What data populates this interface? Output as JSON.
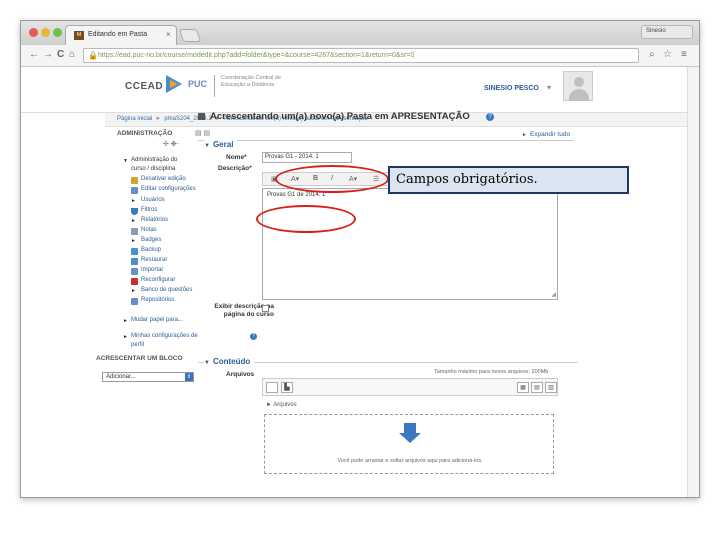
{
  "browser": {
    "tab_title": "Editando em Pasta",
    "tab_favicon": "M",
    "tab_close": "×",
    "user_chip": "Sinesio",
    "url": "https://ead.puc-rio.br/course/modedit.php?add=folder&type=&course=4267&section=1&return=0&sr=0",
    "nav": {
      "back": "←",
      "forward": "→",
      "reload": "C",
      "home": "⌂"
    },
    "toolbar_icons": {
      "bookmark": "☆",
      "zoom": "⌕",
      "menu": "≡"
    }
  },
  "header": {
    "logo_text": "CCEAD",
    "logo_puc": "PUC",
    "subtitle": "Coordenação Central de Educação a Distância",
    "username": "SINESIO PESCO",
    "user_caret": "▾"
  },
  "breadcrumb": [
    "Página inicial",
    "pmaS204_2014.2",
    "Acrescentando um(a) novo(a) pasta em Apresentação"
  ],
  "breadcrumb_sep": "►",
  "sidebar": {
    "admin_title": "ADMINISTRAÇÃO",
    "admin_controls": "▤ ▤",
    "admin_controls2": "✣ ✤-",
    "items": [
      {
        "label": "Administração do",
        "arrow": "▼"
      },
      {
        "label": "curso / disciplina"
      },
      {
        "label": "Desativar edição"
      },
      {
        "label": "Editar configurações"
      },
      {
        "label": "Usuários",
        "arrow": "►"
      },
      {
        "label": "Filtros"
      },
      {
        "label": "Relatórios",
        "arrow": "►"
      },
      {
        "label": "Notas"
      },
      {
        "label": "Badges",
        "arrow": "►"
      },
      {
        "label": "Backup"
      },
      {
        "label": "Restaurar"
      },
      {
        "label": "Importar"
      },
      {
        "label": "Reconfigurar"
      },
      {
        "label": "Banco de questões",
        "arrow": "►"
      },
      {
        "label": "Repositórios"
      },
      {
        "label": "Mudar papel para...",
        "arrow": "►"
      },
      {
        "label": "Minhas configurações de",
        "arrow": "►"
      },
      {
        "label": "perfil"
      }
    ],
    "add_block_title": "ACRESCENTAR UM BLOCO",
    "add_block_select": "Adicionar...",
    "add_block_arrow": "⇕"
  },
  "main": {
    "heading": "Acrescentando um(a) novo(a) Pasta em APRESENTAÇÃO",
    "help_glyph": "?",
    "expand_all": "Expandir tudo",
    "expand_glyph": "►",
    "geral_legend": "Geral",
    "name_label": "Nome*",
    "name_value": "Provas G1 - 2014. 1",
    "desc_label": "Descrição*",
    "editor_buttons": [
      "▣",
      "A▾",
      "B",
      "I",
      "A▾",
      "☰",
      "☷",
      "⌂",
      "✕",
      "⇋",
      "⇤",
      "⇥",
      "</>"
    ],
    "editor_text": "Provas G1 de 2014. 1",
    "resize_glyph": "◢",
    "show_desc_label": "Exibir descrição na página do curso",
    "conteudo_legend": "Conteúdo",
    "files_label": "Arquivos",
    "max_size": "Tamanho máximo para novos arquivos: 200Mb",
    "fp_folder_glyph": "▙",
    "fp_views": [
      "▦",
      "▤",
      "▥"
    ],
    "fp_path": "► Arquivos",
    "drop_text": "Você pode arrastar e soltar arquivos aqui para adicioná-los."
  },
  "annotation": {
    "tooltip": "Campos obrigatórios.",
    "ellipse_color": "#d8201a"
  }
}
